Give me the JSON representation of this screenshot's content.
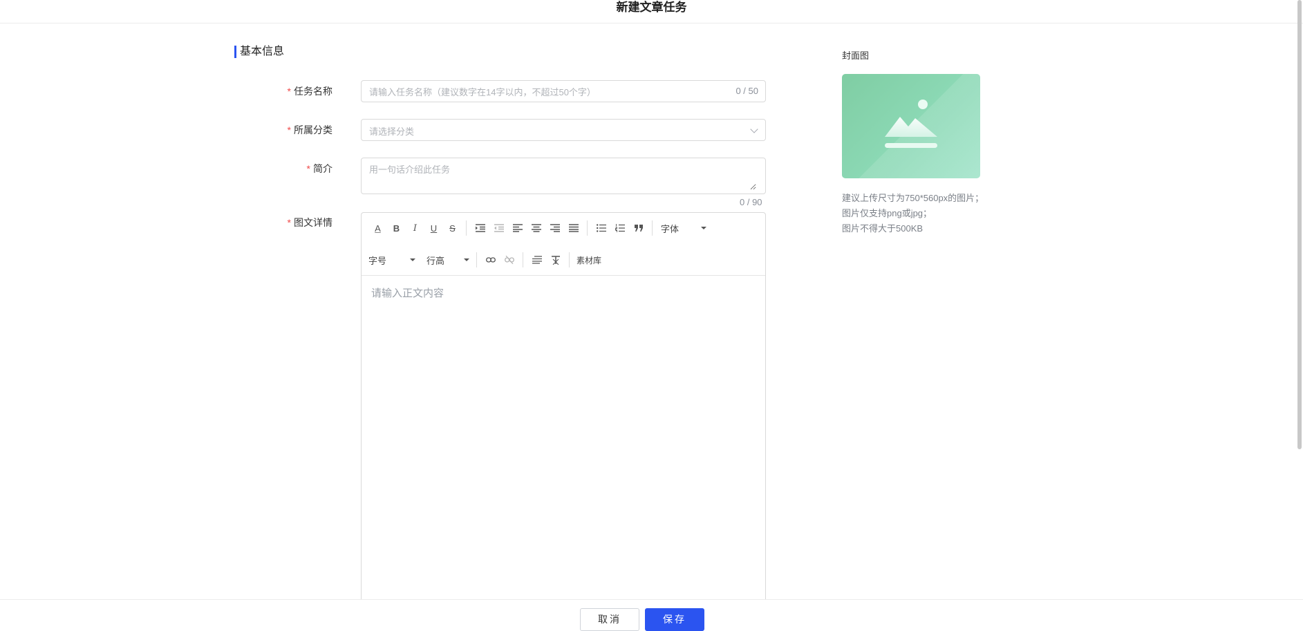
{
  "page": {
    "title": "新建文章任务"
  },
  "section": {
    "title": "基本信息"
  },
  "form": {
    "required_mark": "*",
    "task_name": {
      "label": "任务名称",
      "placeholder": "请输入任务名称（建议数字在14字以内，不超过50个字）",
      "value": "",
      "count": "0 / 50"
    },
    "category": {
      "label": "所属分类",
      "placeholder": "请选择分类",
      "value": ""
    },
    "intro": {
      "label": "简介",
      "placeholder": "用一句话介绍此任务",
      "value": "",
      "count": "0 / 90"
    },
    "content": {
      "label": "图文详情",
      "placeholder": "请输入正文内容"
    }
  },
  "toolbar": {
    "row1": {
      "font_color": "A",
      "bold": "B",
      "italic": "I",
      "underline": "U",
      "strikethrough": "S",
      "font_family": "字体"
    },
    "row2": {
      "font_size": "字号",
      "line_height": "行高",
      "material_library": "素材库"
    }
  },
  "cover": {
    "label": "封面图",
    "hints": [
      "建议上传尺寸为750*560px的图片；",
      "图片仅支持png或jpg；",
      "图片不得大于500KB"
    ],
    "placeholder_color": "#8bd8b4"
  },
  "footer": {
    "cancel_label": "取消",
    "save_label": "保存"
  },
  "colors": {
    "primary": "#2b54f0",
    "required": "#f04a4a"
  },
  "icons": [
    "font-color-icon",
    "bold-icon",
    "italic-icon",
    "underline-icon",
    "strikethrough-icon",
    "indent-icon",
    "outdent-icon",
    "align-left-icon",
    "align-center-icon",
    "align-right-icon",
    "align-justify-icon",
    "bullet-list-icon",
    "ordered-list-icon",
    "quote-icon",
    "link-icon",
    "unlink-icon",
    "paragraph-format-icon",
    "clear-format-icon",
    "image-placeholder-icon",
    "chevron-down-icon"
  ]
}
